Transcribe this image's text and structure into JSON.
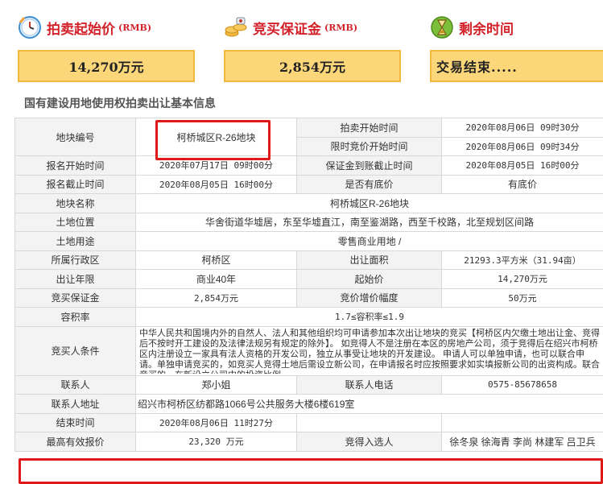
{
  "summary": {
    "start_price": {
      "icon": "clock-icon",
      "label": "拍卖起始价",
      "unit": "(RMB)",
      "value": "14,270万元"
    },
    "deposit": {
      "icon": "coins-icon",
      "label": "竞买保证金",
      "unit": "(RMB)",
      "value": "2,854万元"
    },
    "remaining": {
      "icon": "hourglass-icon",
      "label": "剩余时间",
      "value": "交易结束....."
    }
  },
  "section_title": "国有建设用地使用权拍卖出让基本信息",
  "table": {
    "plot_no_label": "地块编号",
    "plot_no": "柯桥城区R-26地块",
    "auction_start_label": "拍卖开始时间",
    "auction_start": "2020年08月06日 09时30分",
    "limit_start_label": "限时竞价开始时间",
    "limit_start": "2020年08月06日 09时34分",
    "reg_start_label": "报名开始时间",
    "reg_start": "2020年07月17日 09时00分",
    "deposit_deadline_label": "保证金到账截止时间",
    "deposit_deadline": "2020年08月05日 16时00分",
    "reg_end_label": "报名截止时间",
    "reg_end": "2020年08月05日 16时00分",
    "reserve_label": "是否有底价",
    "reserve": "有底价",
    "plot_name_label": "地块名称",
    "plot_name": "柯桥城区R-26地块",
    "location_label": "土地位置",
    "location": "华舍街道华墟居，东至华墟直江，南至鉴湖路，西至千校路，北至规划区间路",
    "usage_label": "土地用途",
    "usage": "零售商业用地 /",
    "district_label": "所属行政区",
    "district": "柯桥区",
    "area_label": "出让面积",
    "area": "21293.3平方米（31.94亩）",
    "years_label": "出让年限",
    "years": "商业40年",
    "start_price_label": "起始价",
    "start_price": "14,270万元",
    "deposit_label": "竞买保证金",
    "deposit": "2,854万元",
    "increment_label": "竞价增价幅度",
    "increment": "50万元",
    "far_label": "容积率",
    "far": "1.7≤容积率≤1.9",
    "conditions_label": "竞买人条件",
    "conditions": "中华人民共和国境内外的自然人、法人和其他组织均可申请参加本次出让地块的竞买【柯桥区内欠缴土地出让金、竞得后不按时开工建设的及法律法规另有规定的除外】。 如竞得人不是注册在本区的房地产公司，须于竞得后在绍兴市柯桥区内注册设立一家具有法人资格的开发公司，独立从事受让地块的开发建设。 申请人可以单独申请，也可以联合申请。单独申请竞买的，如竞买人竞得土地后需设立新公司，在申请报名时应按照要求如实填报新公司的出资构成。联合竞买的，在新设立公司中的投资比例",
    "contact_label": "联系人",
    "contact": "郑小姐",
    "phone_label": "联系人电话",
    "phone": "0575-85678658",
    "address_label": "联系人地址",
    "address": "绍兴市柯桥区纺都路1066号公共服务大楼6楼619室",
    "end_time_label": "结束时间",
    "end_time": "2020年08月06日 11时27分",
    "highest_bid_label": "最高有效报价",
    "highest_bid": "23,320 万元",
    "winner_label": "竞得入选人",
    "winner": "徐冬泉 徐海青 李尚 林建军 吕卫兵"
  },
  "colors": {
    "accent_red": "#d3222a",
    "box_fill": "#fcd77a",
    "box_border": "#f4b73e",
    "highlight": "#e01818"
  }
}
